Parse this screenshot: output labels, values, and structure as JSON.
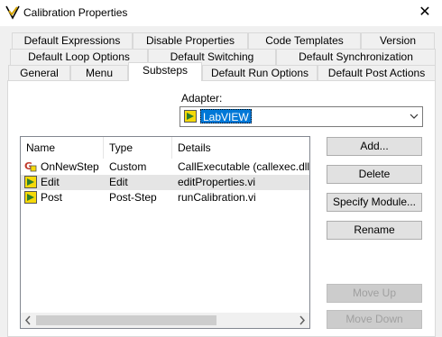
{
  "window": {
    "title": "Calibration Properties",
    "icon": "check-v-icon",
    "close": "✕"
  },
  "tabs": {
    "row1": [
      "Default Expressions",
      "Disable Properties",
      "Code Templates",
      "Version"
    ],
    "row2": [
      "Default Loop Options",
      "Default Switching",
      "Default Synchronization"
    ],
    "row3": [
      "General",
      "Menu",
      "Substeps",
      "Default Run Options",
      "Default Post Actions"
    ],
    "active": "Substeps"
  },
  "adapter": {
    "label": "Adapter:",
    "value": "LabVIEW",
    "icon": "labview-icon"
  },
  "list": {
    "columns": [
      "Name",
      "Type",
      "Details"
    ],
    "rows": [
      {
        "name": "OnNewStep",
        "type": "Custom",
        "details": "CallExecutable (callexec.dll)",
        "icon": "executable-icon"
      },
      {
        "name": "Edit",
        "type": "Edit",
        "details": "editProperties.vi",
        "icon": "labview-icon",
        "selected": true
      },
      {
        "name": "Post",
        "type": "Post-Step",
        "details": "runCalibration.vi",
        "icon": "labview-icon"
      }
    ]
  },
  "buttons": {
    "add": "Add...",
    "delete": "Delete",
    "specify_module": "Specify Module...",
    "rename": "Rename",
    "move_up": "Move Up",
    "move_down": "Move Down"
  },
  "colors": {
    "selection": "#0078d7",
    "row_highlight": "#e5e5e5",
    "labview_yellow": "#f5d90a"
  }
}
